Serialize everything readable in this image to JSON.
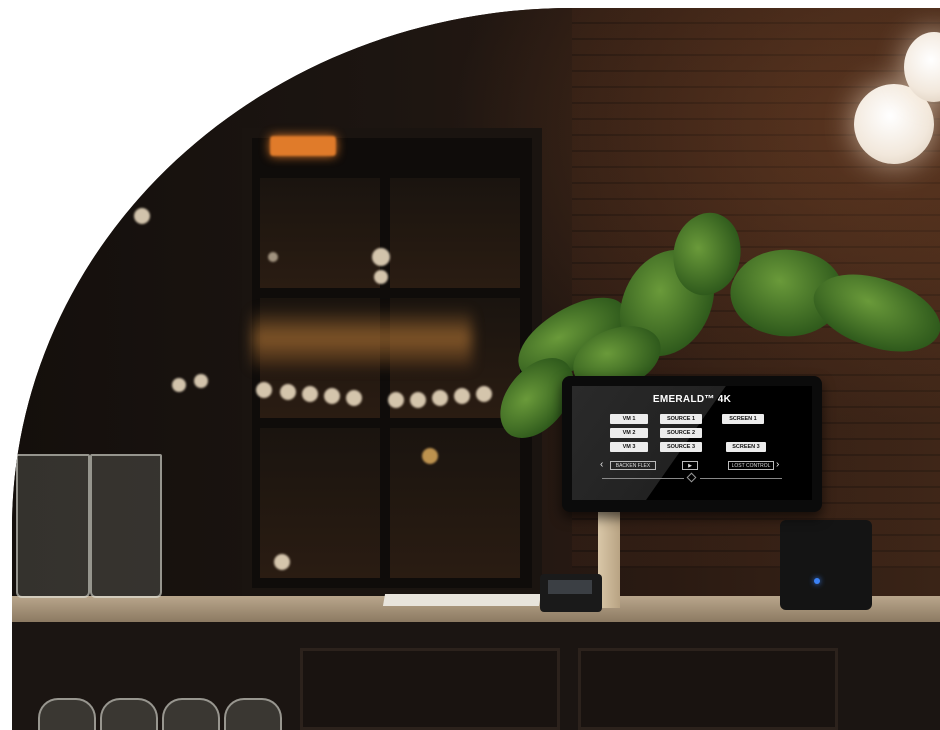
{
  "panel": {
    "title": "EMERALD™ 4K",
    "buttons": [
      {
        "label": "VM 1"
      },
      {
        "label": "SOURCE 1"
      },
      {
        "label": "SCREEN 1"
      },
      {
        "label": "VM 2"
      },
      {
        "label": "SOURCE 2"
      },
      {
        "label": "VM 3"
      },
      {
        "label": "SOURCE 3"
      },
      {
        "label": "SCREEN 3"
      }
    ],
    "nav": {
      "left_label": "BACKEN FLEX",
      "center_icon": "play-icon",
      "right_label": "LOST CONTROL"
    }
  },
  "scene": {
    "sign_color": "#e07b2a",
    "status_led_color": "#3b82f6"
  }
}
